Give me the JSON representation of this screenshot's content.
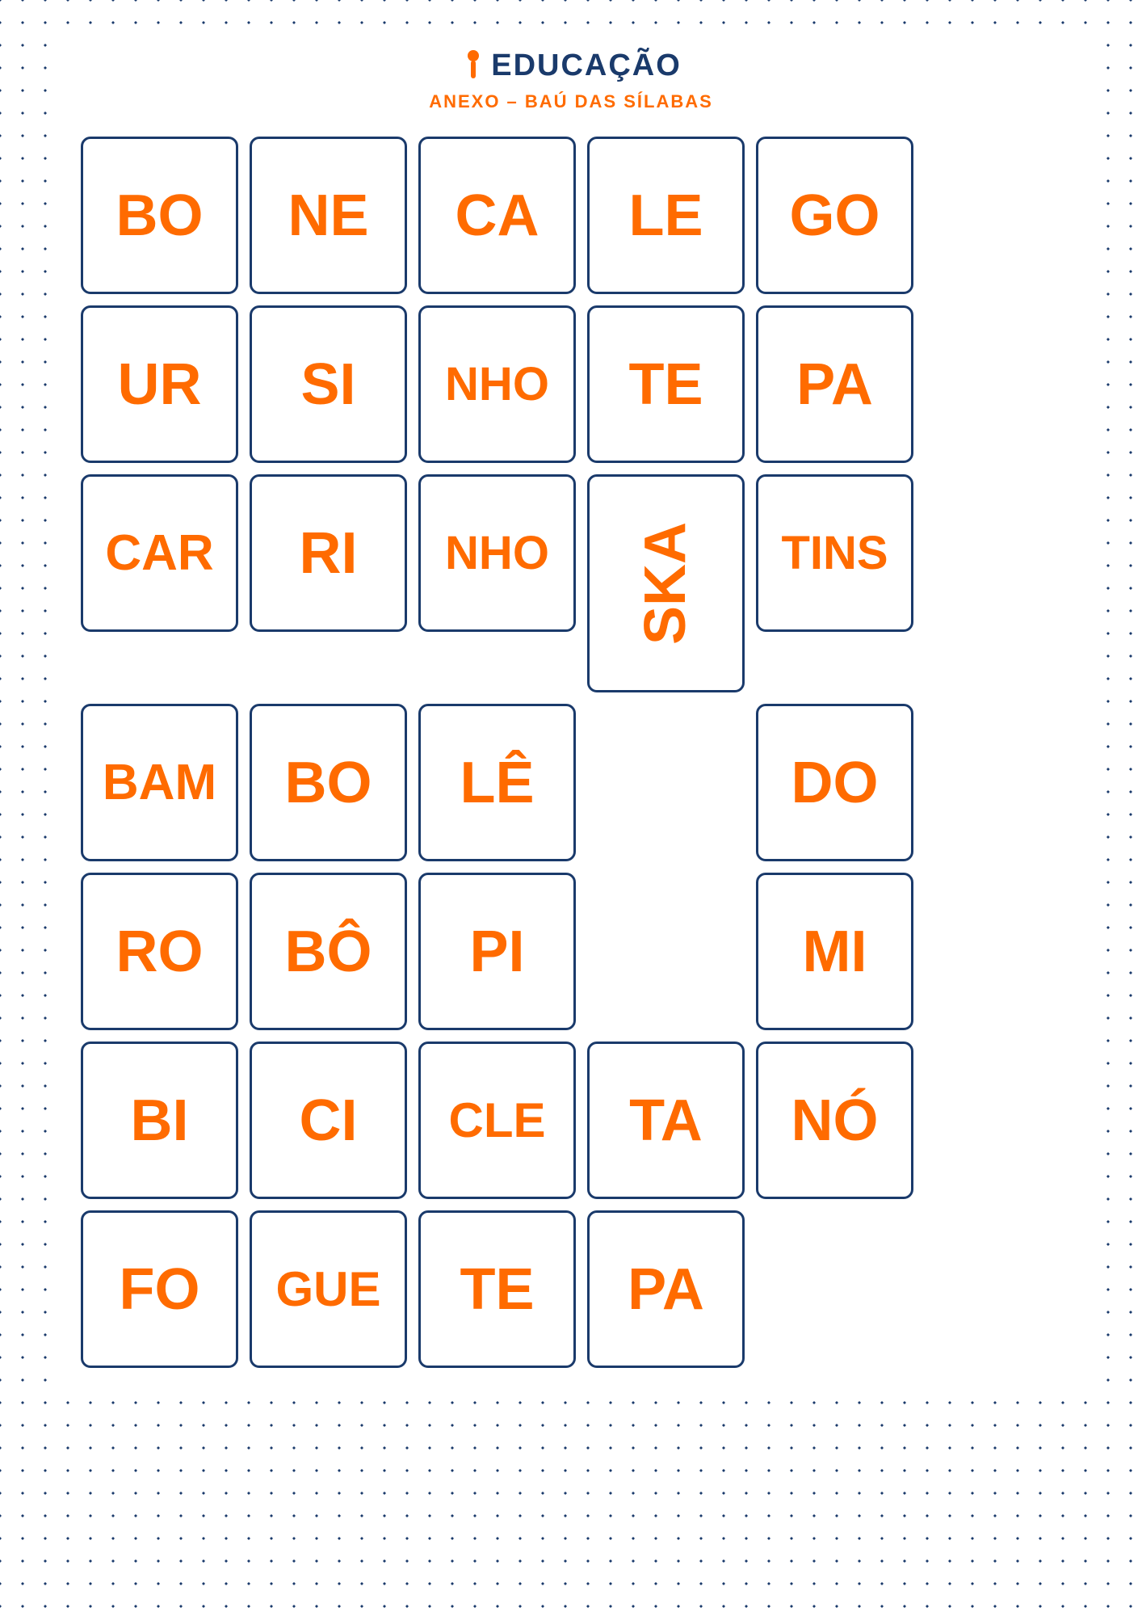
{
  "header": {
    "logo_text": "EDUCAÇÃO",
    "subtitle": "ANEXO – BAÚ DAS SÍLABAS"
  },
  "rows": [
    {
      "id": "row1",
      "cells": [
        {
          "text": "BO",
          "size": "std"
        },
        {
          "text": "NE",
          "size": "std"
        },
        {
          "text": "CA",
          "size": "std"
        },
        {
          "text": "LE",
          "size": "std"
        },
        {
          "text": "GO",
          "size": "std"
        }
      ]
    },
    {
      "id": "row2",
      "cells": [
        {
          "text": "UR",
          "size": "std"
        },
        {
          "text": "SI",
          "size": "std"
        },
        {
          "text": "NHO",
          "size": "std"
        },
        {
          "text": "TE",
          "size": "std"
        },
        {
          "text": "PA",
          "size": "std"
        }
      ]
    },
    {
      "id": "row3",
      "cells": [
        {
          "text": "CAR",
          "size": "std"
        },
        {
          "text": "RI",
          "size": "std"
        },
        {
          "text": "NHO",
          "size": "std"
        },
        {
          "text": "SKA",
          "size": "tall",
          "rotated": true
        },
        {
          "text": "TINS",
          "size": "std"
        }
      ]
    },
    {
      "id": "row4",
      "cells": [
        {
          "text": "BAM",
          "size": "std"
        },
        {
          "text": "BO",
          "size": "std"
        },
        {
          "text": "LÊ",
          "size": "std"
        },
        {
          "text": "",
          "size": "gap"
        },
        {
          "text": "DO",
          "size": "std"
        }
      ]
    },
    {
      "id": "row5",
      "cells": [
        {
          "text": "RO",
          "size": "std"
        },
        {
          "text": "BÔ",
          "size": "std"
        },
        {
          "text": "PI",
          "size": "std"
        },
        {
          "text": "",
          "size": "gap"
        },
        {
          "text": "MI",
          "size": "std"
        }
      ]
    },
    {
      "id": "row6",
      "cells": [
        {
          "text": "BI",
          "size": "std"
        },
        {
          "text": "CI",
          "size": "std"
        },
        {
          "text": "CLE",
          "size": "std"
        },
        {
          "text": "TA",
          "size": "std"
        },
        {
          "text": "NÓ",
          "size": "std"
        }
      ]
    },
    {
      "id": "row7",
      "cells": [
        {
          "text": "FO",
          "size": "std"
        },
        {
          "text": "GUE",
          "size": "std"
        },
        {
          "text": "TE",
          "size": "std"
        },
        {
          "text": "PA",
          "size": "std"
        },
        {
          "text": "",
          "size": "gap"
        }
      ]
    }
  ]
}
